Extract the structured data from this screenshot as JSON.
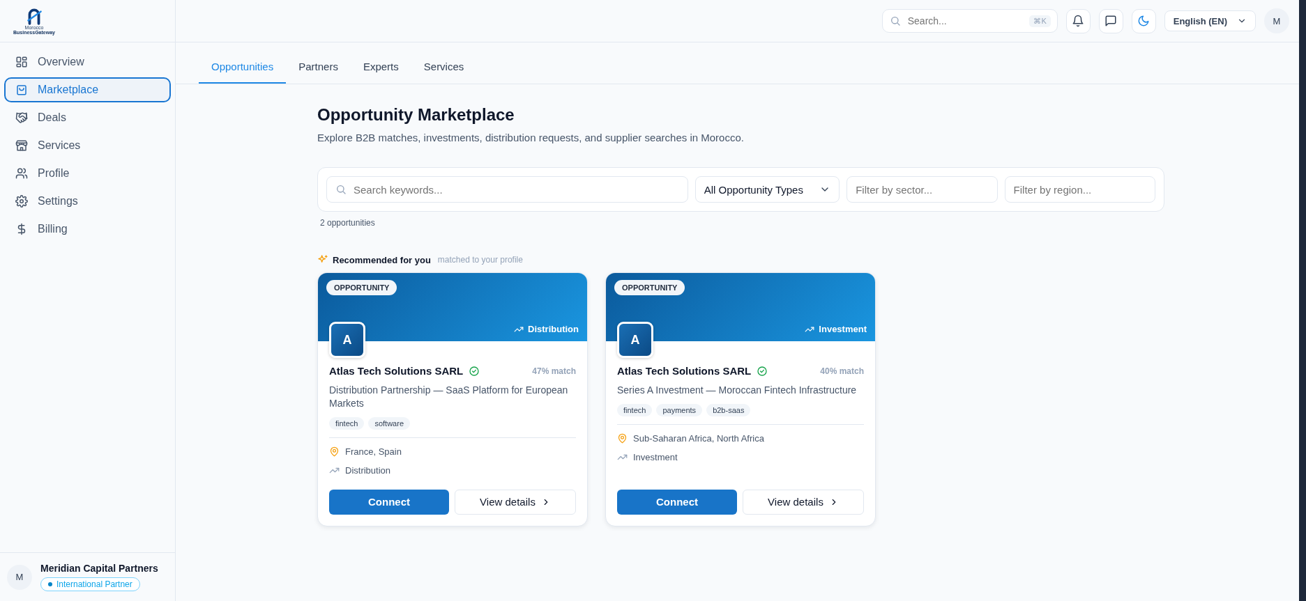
{
  "logo": {
    "line_1": "Morocco",
    "line_2": "BusinessGateway"
  },
  "sidebar": {
    "items": [
      {
        "label": "Overview",
        "selected": false
      },
      {
        "label": "Marketplace",
        "selected": true
      },
      {
        "label": "Deals",
        "selected": false
      },
      {
        "label": "Services",
        "selected": false
      },
      {
        "label": "Profile",
        "selected": false
      },
      {
        "label": "Settings",
        "selected": false
      },
      {
        "label": "Billing",
        "selected": false
      }
    ],
    "account": {
      "avatar": "M",
      "name": "Meridian Capital Partners",
      "badge": "International Partner"
    }
  },
  "header": {
    "search": {
      "placeholder": "Search...",
      "shortcut": "⌘K"
    },
    "language": "English (EN)",
    "avatar": "M"
  },
  "tabs": [
    {
      "label": "Opportunities",
      "selected": true
    },
    {
      "label": "Partners",
      "selected": false
    },
    {
      "label": "Experts",
      "selected": false
    },
    {
      "label": "Services",
      "selected": false
    }
  ],
  "page": {
    "title": "Opportunity Marketplace",
    "subtitle": "Explore B2B matches, investments, distribution requests, and supplier searches in Morocco."
  },
  "filters": {
    "keyword_placeholder": "Search keywords...",
    "type_select": "All Opportunity Types",
    "sector_placeholder": "Filter by sector...",
    "region_placeholder": "Filter by region..."
  },
  "result_count": "2 opportunities",
  "recommended": {
    "title": "Recommended for you",
    "note": "matched to your profile"
  },
  "cards": [
    {
      "badge": "OPPORTUNITY",
      "category": "Distribution",
      "avatar": "A",
      "company": "Atlas Tech Solutions SARL",
      "verified": true,
      "match": "47% match",
      "title": "Distribution Partnership — SaaS Platform for European Markets",
      "tags": [
        "fintech",
        "software"
      ],
      "location": "France, Spain",
      "type": "Distribution",
      "primary_button": "Connect",
      "secondary_button": "View details"
    },
    {
      "badge": "OPPORTUNITY",
      "category": "Investment",
      "avatar": "A",
      "company": "Atlas Tech Solutions SARL",
      "verified": true,
      "match": "40% match",
      "title": "Series A Investment — Moroccan Fintech Infrastructure",
      "tags": [
        "fintech",
        "payments",
        "b2b-saas"
      ],
      "location": "Sub-Saharan Africa, North Africa",
      "type": "Investment",
      "primary_button": "Connect",
      "secondary_button": "View details"
    }
  ]
}
